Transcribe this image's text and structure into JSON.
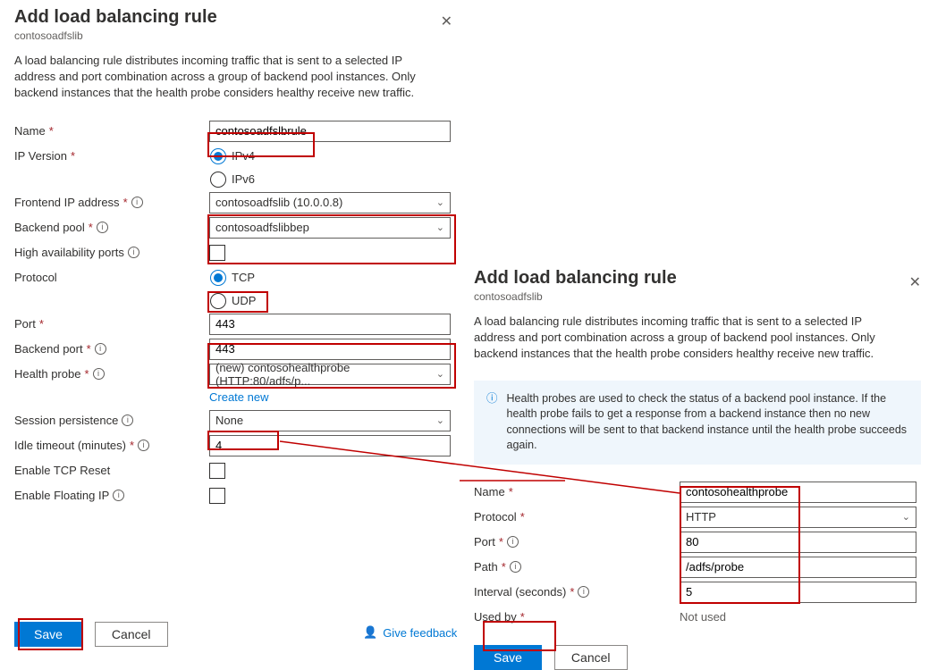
{
  "left": {
    "title": "Add load balancing rule",
    "subtitle": "contosoadfslib",
    "desc": "A load balancing rule distributes incoming traffic that is sent to a selected IP address and port combination across a group of backend pool instances. Only backend instances that the health probe considers healthy receive new traffic.",
    "labels": {
      "name": "Name",
      "ipver": "IP Version",
      "feip": "Frontend IP address",
      "bepool": "Backend pool",
      "hap": "High availability ports",
      "protocol": "Protocol",
      "port": "Port",
      "beport": "Backend port",
      "probe": "Health probe",
      "createnew": "Create new",
      "session": "Session persistence",
      "idle": "Idle timeout (minutes)",
      "tcprst": "Enable TCP Reset",
      "floatip": "Enable Floating IP"
    },
    "values": {
      "name": "contosoadfslbrule",
      "ipv4": "IPv4",
      "ipv6": "IPv6",
      "feip": "contosoadfslib (10.0.0.8)",
      "bepool": "contosoadfslibbep",
      "tcp": "TCP",
      "udp": "UDP",
      "port": "443",
      "beport": "443",
      "probe": "(new) contosohealthprobe (HTTP:80/adfs/p...",
      "session": "None",
      "idle": "4"
    },
    "buttons": {
      "save": "Save",
      "cancel": "Cancel",
      "feedback": "Give feedback"
    }
  },
  "right": {
    "title": "Add load balancing rule",
    "subtitle": "contosoadfslib",
    "desc": "A load balancing rule distributes incoming traffic that is sent to a selected IP address and port combination across a group of backend pool instances. Only backend instances that the health probe considers healthy receive new traffic.",
    "info": "Health probes are used to check the status of a backend pool instance. If the health probe fails to get a response from a backend instance then no new connections will be sent to that backend instance until the health probe succeeds again.",
    "labels": {
      "name": "Name",
      "protocol": "Protocol",
      "port": "Port",
      "path": "Path",
      "interval": "Interval (seconds)",
      "usedby": "Used by"
    },
    "values": {
      "name": "contosohealthprobe",
      "protocol": "HTTP",
      "port": "80",
      "path": "/adfs/probe",
      "interval": "5",
      "usedby": "Not used"
    },
    "buttons": {
      "save": "Save",
      "cancel": "Cancel"
    }
  }
}
